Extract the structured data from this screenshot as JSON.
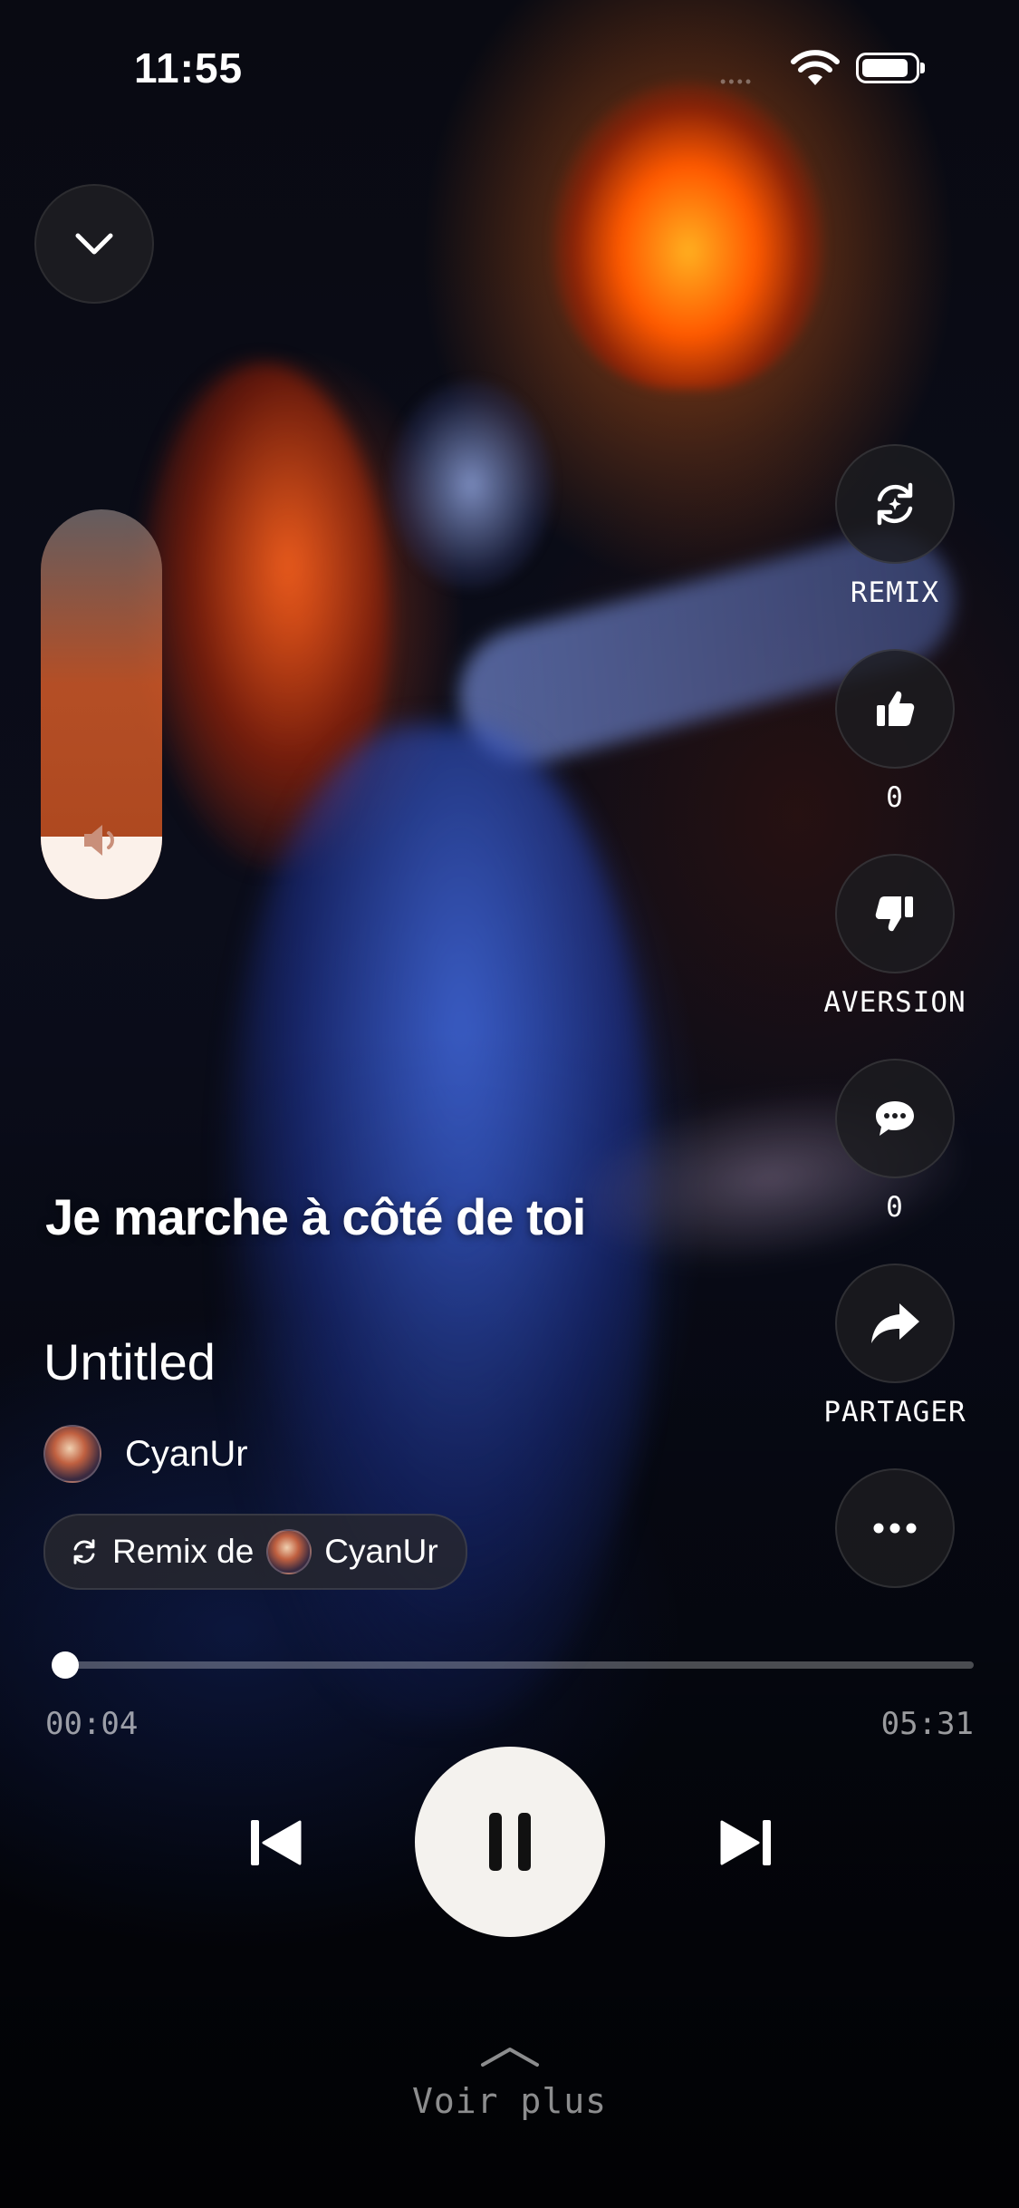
{
  "status_bar": {
    "time": "11:55"
  },
  "volume": {
    "level": 0.16
  },
  "actions": {
    "remix_label": "REMIX",
    "like_count": "0",
    "dislike_label": "AVERSION",
    "comment_count": "0",
    "share_label": "PARTAGER"
  },
  "track": {
    "lyric_line": "Je marche à côté de toi",
    "title": "Untitled",
    "artist": "CyanUr",
    "remix_prefix": "Remix de",
    "remix_artist": "CyanUr"
  },
  "progress": {
    "elapsed": "00:04",
    "duration": "05:31",
    "fraction": 0.012
  },
  "footer": {
    "see_more": "Voir plus"
  },
  "colors": {
    "accent_light": "#f4f2ee",
    "volume_fill": "#fbf1ea",
    "button_bg": "#1c1c20"
  }
}
